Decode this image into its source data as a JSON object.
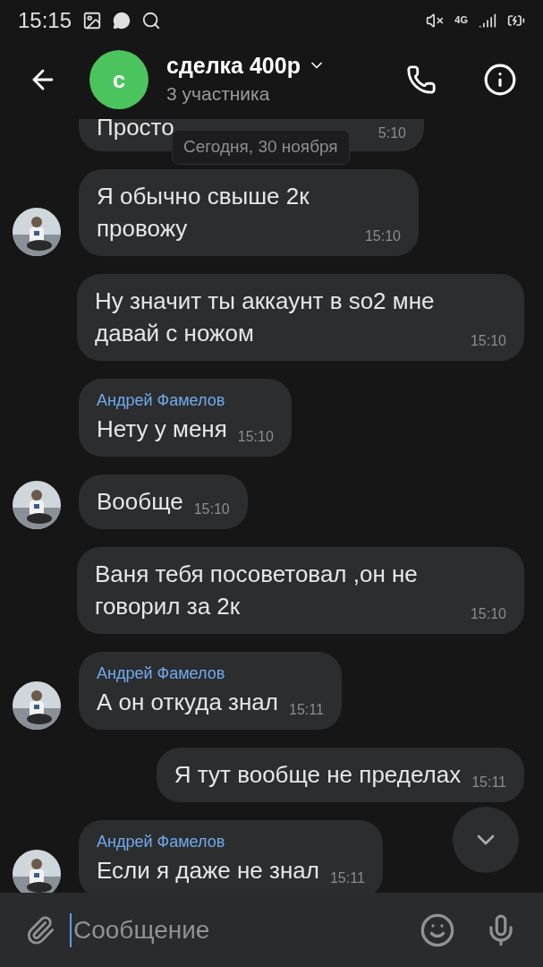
{
  "status_bar": {
    "time": "15:15",
    "network": "4G"
  },
  "header": {
    "avatar_letter": "с",
    "title": "сделка 400р",
    "subtitle": "3 участника"
  },
  "date_badge": "Сегодня, 30 ноября",
  "messages": [
    {
      "kind": "clipped",
      "text": "Просто",
      "time": "5:10"
    },
    {
      "kind": "incoming",
      "text": "Я обычно свыше 2к провожу",
      "time": "15:10",
      "avatar": true
    },
    {
      "kind": "outgoing",
      "text": "Ну значит ты аккаунт в so2 мне давай с ножом",
      "time": "15:10"
    },
    {
      "kind": "incoming",
      "sender": "Андрей Фамелов",
      "text": "Нету у меня",
      "time": "15:10",
      "avatar": false
    },
    {
      "kind": "incoming",
      "text": "Вообще",
      "time": "15:10",
      "avatar": true
    },
    {
      "kind": "outgoing",
      "text": "Ваня тебя посоветовал ,он не говорил за 2к",
      "time": "15:10"
    },
    {
      "kind": "incoming",
      "sender": "Андрей Фамелов",
      "text": "А он откуда знал",
      "time": "15:11",
      "avatar": true
    },
    {
      "kind": "outgoing",
      "text": "Я тут вообще не пределах",
      "time": "15:11"
    },
    {
      "kind": "incoming",
      "sender": "Андрей Фамелов",
      "text": "Если я даже не знал",
      "time": "15:11",
      "avatar": true
    }
  ],
  "composer": {
    "placeholder": "Сообщение"
  }
}
